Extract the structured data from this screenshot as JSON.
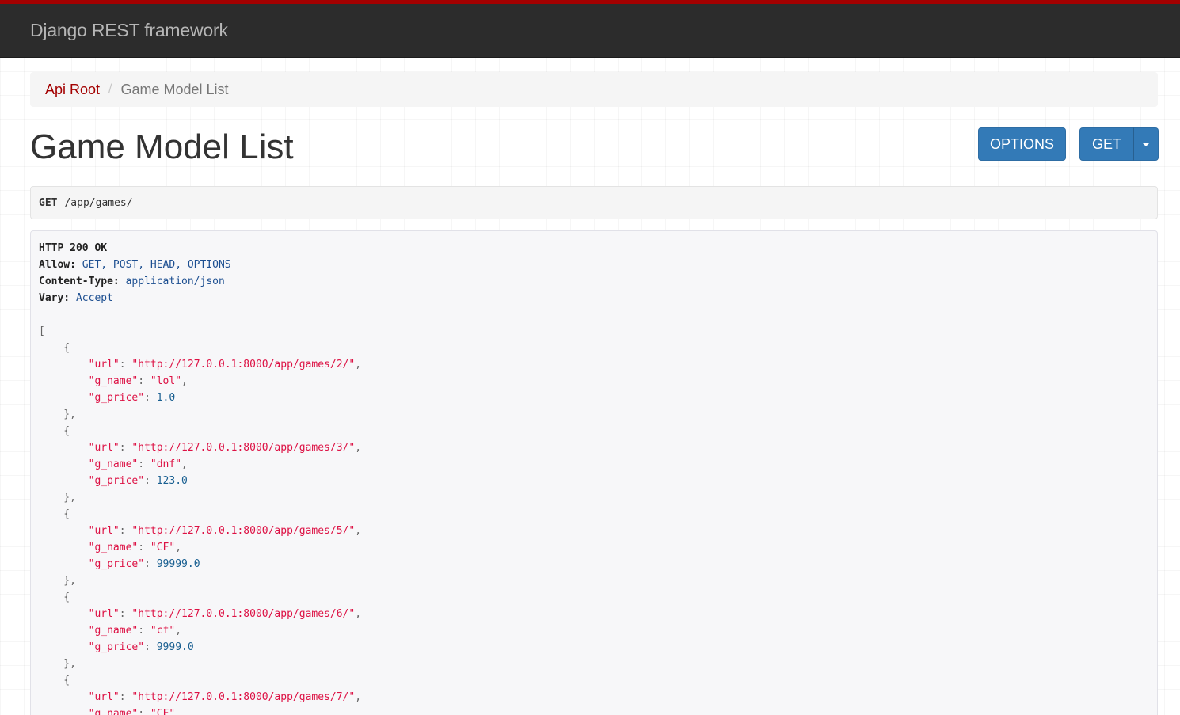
{
  "navbar": {
    "brand": "Django REST framework"
  },
  "breadcrumb": {
    "root": "Api Root",
    "separator": "/",
    "current": "Game Model List"
  },
  "page": {
    "title": "Game Model List"
  },
  "buttons": {
    "options": "OPTIONS",
    "get": "GET"
  },
  "request": {
    "method": "GET",
    "path": "/app/games/"
  },
  "response": {
    "status": "HTTP 200 OK",
    "headers": [
      {
        "key": "Allow:",
        "value": "GET, POST, HEAD, OPTIONS"
      },
      {
        "key": "Content-Type:",
        "value": "application/json"
      },
      {
        "key": "Vary:",
        "value": "Accept"
      }
    ],
    "open_bracket": "[",
    "items": [
      {
        "url": "\"http://127.0.0.1:8000/app/games/2/\"",
        "g_name": "\"lol\"",
        "g_price": "1.0"
      },
      {
        "url": "\"http://127.0.0.1:8000/app/games/3/\"",
        "g_name": "\"dnf\"",
        "g_price": "123.0"
      },
      {
        "url": "\"http://127.0.0.1:8000/app/games/5/\"",
        "g_name": "\"CF\"",
        "g_price": "99999.0"
      },
      {
        "url": "\"http://127.0.0.1:8000/app/games/6/\"",
        "g_name": "\"cf\"",
        "g_price": "9999.0"
      },
      {
        "url": "\"http://127.0.0.1:8000/app/games/7/\"",
        "g_name": "\"CF\"",
        "g_price": ""
      }
    ],
    "keys": {
      "url": "\"url\"",
      "g_name": "\"g_name\"",
      "g_price": "\"g_price\""
    }
  },
  "colors": {
    "navbar_bg": "#2c2c2c",
    "accent_red": "#a30000",
    "button_blue": "#337ab7",
    "json_string": "#dd1144",
    "json_number": "#195f91"
  }
}
